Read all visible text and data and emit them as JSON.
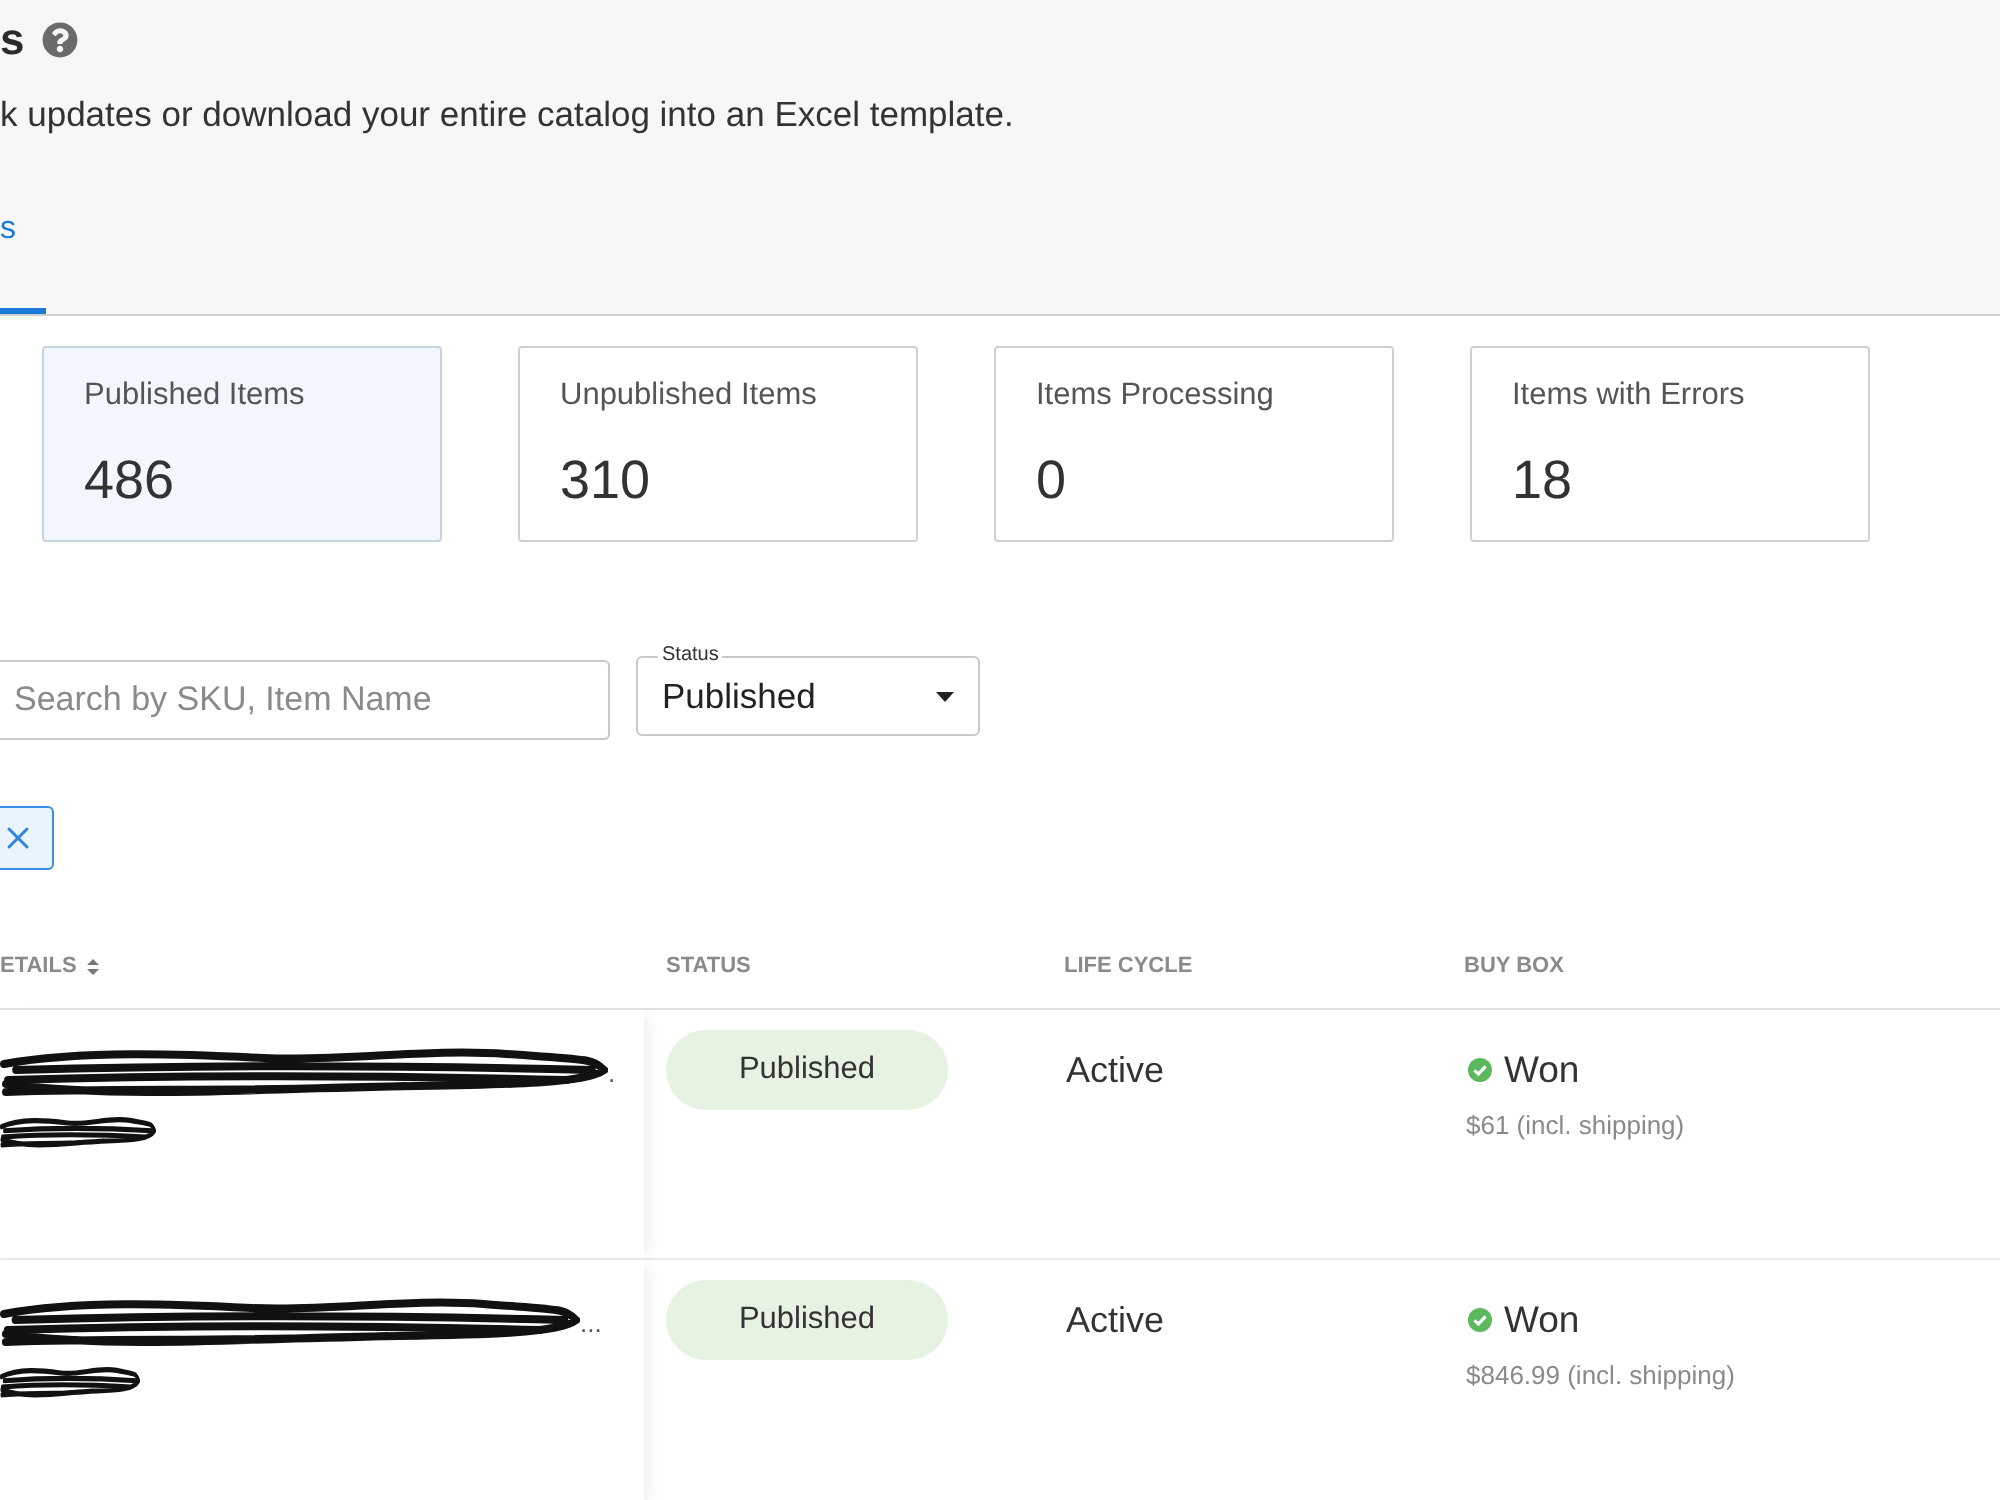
{
  "page": {
    "title": "s",
    "description": "k updates or download your entire catalog into an Excel template."
  },
  "tabs": [
    {
      "label": "s",
      "selected": true
    }
  ],
  "summary_cards": [
    {
      "label": "Published Items",
      "value": "486",
      "selected": true
    },
    {
      "label": "Unpublished Items",
      "value": "310",
      "selected": false
    },
    {
      "label": "Items Processing",
      "value": "0",
      "selected": false
    },
    {
      "label": "Items with Errors",
      "value": "18",
      "selected": false
    }
  ],
  "filters": {
    "search": {
      "placeholder": "Search by SKU, Item Name"
    },
    "status": {
      "label": "Status",
      "value": "Published"
    }
  },
  "table": {
    "columns": [
      {
        "label": "ETAILS",
        "sortable": true
      },
      {
        "label": "STATUS",
        "sortable": false
      },
      {
        "label": "LIFE CYCLE",
        "sortable": false
      },
      {
        "label": "BUY BOX",
        "sortable": false
      }
    ],
    "rows": [
      {
        "details_tail": ".",
        "status": "Published",
        "life_cycle": "Active",
        "buy_box": {
          "result": "Won",
          "price": "$61 (incl. shipping)"
        }
      },
      {
        "details_tail": "...",
        "status": "Published",
        "life_cycle": "Active",
        "buy_box": {
          "result": "Won",
          "price": "$846.99 (incl. shipping)"
        }
      }
    ]
  }
}
